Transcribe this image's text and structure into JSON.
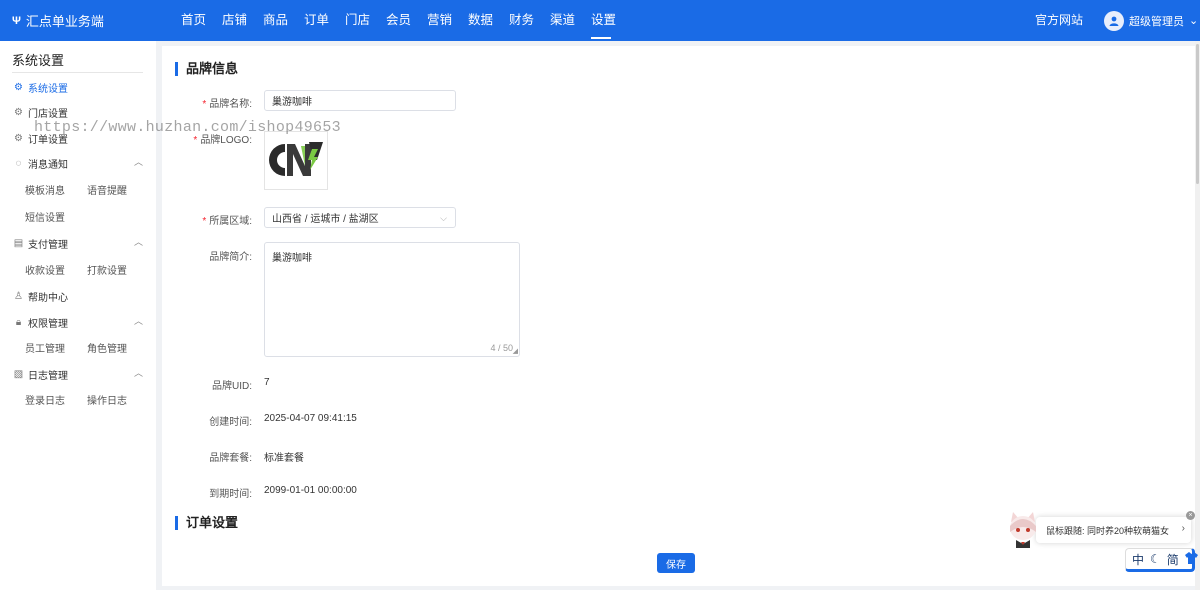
{
  "app": {
    "title": "汇点单业务端",
    "logo_mark": "Ψ"
  },
  "nav": {
    "items": [
      "首页",
      "店铺",
      "商品",
      "订单",
      "门店",
      "会员",
      "营销",
      "数据",
      "财务",
      "渠道",
      "设置"
    ],
    "active": "设置",
    "official_site": "官方网站",
    "user_name": "超级管理员",
    "user_chevron": "⌄"
  },
  "sidebar": {
    "title": "系统设置",
    "items": [
      {
        "label": "系统设置",
        "icon": "gear-icon",
        "active": true
      },
      {
        "label": "门店设置",
        "icon": "gear-icon"
      },
      {
        "label": "订单设置",
        "icon": "gear-icon"
      },
      {
        "label": "消息通知",
        "icon": "chat-icon",
        "expanded": true,
        "children": [
          "模板消息",
          "语音提醒",
          "短信设置"
        ]
      },
      {
        "label": "支付管理",
        "icon": "wallet-icon",
        "expanded": true,
        "children": [
          "收款设置",
          "打款设置"
        ]
      },
      {
        "label": "帮助中心",
        "icon": "user-icon"
      },
      {
        "label": "权限管理",
        "icon": "lock-icon",
        "expanded": true,
        "children": [
          "员工管理",
          "角色管理"
        ]
      },
      {
        "label": "日志管理",
        "icon": "document-icon",
        "expanded": true,
        "children": [
          "登录日志",
          "操作日志"
        ]
      }
    ]
  },
  "brand_section": {
    "title": "品牌信息",
    "name_label": "品牌名称:",
    "name_value": "巢游咖啡",
    "logo_label": "品牌LOGO:",
    "region_label": "所属区域:",
    "region_value": "山西省 / 运城市 / 盐湖区",
    "intro_label": "品牌简介:",
    "intro_value": "巢游咖啡",
    "intro_counter": "4 / 50",
    "uid_label": "品牌UID:",
    "uid_value": "7",
    "created_label": "创建时间:",
    "created_value": "2025-04-07 09:41:15",
    "plan_label": "品牌套餐:",
    "plan_value": "标准套餐",
    "expire_label": "到期时间:",
    "expire_value": "2099-01-01 00:00:00"
  },
  "order_section": {
    "title": "订单设置"
  },
  "save_label": "保存",
  "watermark": "https://www.huzhan.com/ishop49653",
  "pet_widget": {
    "text": "鼠标跟随: 同时养20种软萌猫女",
    "arrow": "›",
    "close": "×"
  },
  "lang_widget": {
    "lang_cn": "中",
    "moon": "☾",
    "simplified": "简",
    "shirt": "👕"
  },
  "colors": {
    "primary": "#1a6be6",
    "required": "#f5222d"
  }
}
